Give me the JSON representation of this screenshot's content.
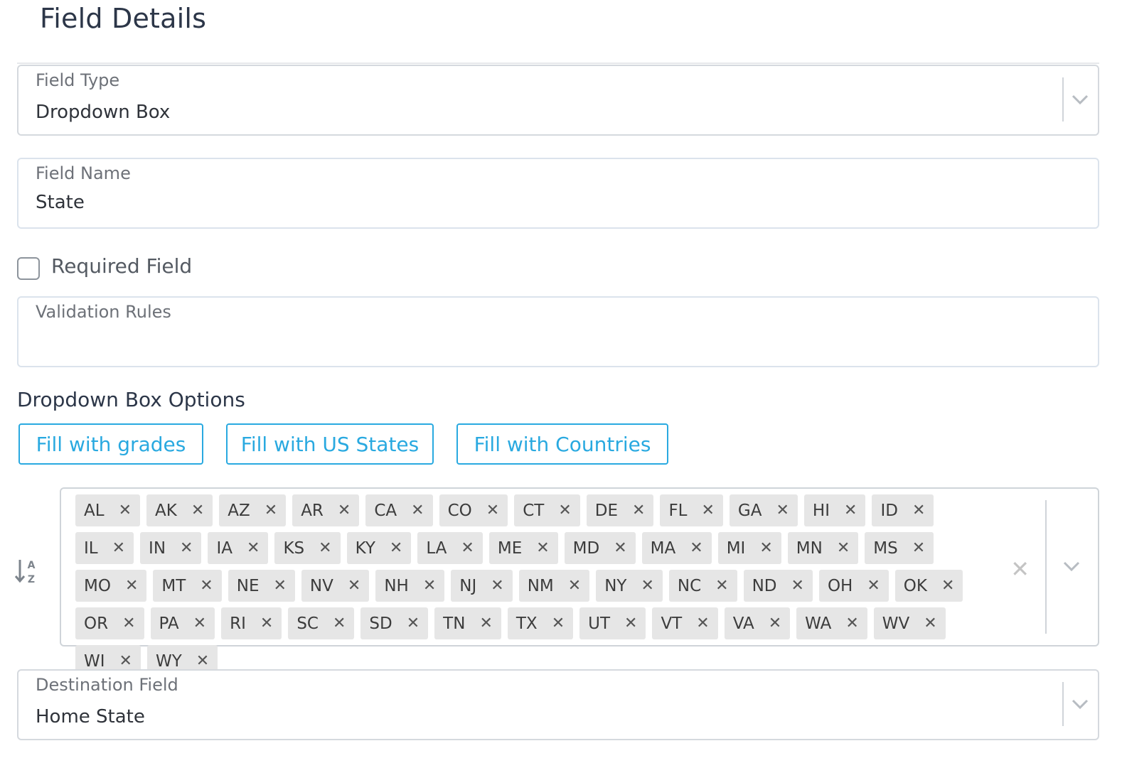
{
  "page": {
    "title": "Field Details"
  },
  "field_type": {
    "label": "Field Type",
    "value": "Dropdown Box"
  },
  "field_name": {
    "label": "Field Name",
    "value": "State"
  },
  "required": {
    "label": "Required Field",
    "checked": false
  },
  "validation": {
    "label": "Validation Rules",
    "value": ""
  },
  "options": {
    "heading": "Dropdown Box Options",
    "buttons": {
      "grades": "Fill with grades",
      "us_states": "Fill with US States",
      "countries": "Fill with Countries"
    },
    "tags": [
      "AL",
      "AK",
      "AZ",
      "AR",
      "CA",
      "CO",
      "CT",
      "DE",
      "FL",
      "GA",
      "HI",
      "ID",
      "IL",
      "IN",
      "IA",
      "KS",
      "KY",
      "LA",
      "ME",
      "MD",
      "MA",
      "MI",
      "MN",
      "MS",
      "MO",
      "MT",
      "NE",
      "NV",
      "NH",
      "NJ",
      "NM",
      "NY",
      "NC",
      "ND",
      "OH",
      "OK",
      "OR",
      "PA",
      "RI",
      "SC",
      "SD",
      "TN",
      "TX",
      "UT",
      "VT",
      "VA",
      "WA",
      "WV",
      "WI",
      "WY"
    ],
    "remove_glyph": "✕",
    "clear_glyph": "✕"
  },
  "destination": {
    "label": "Destination Field",
    "value": "Home State"
  },
  "colors": {
    "accent": "#29a9e0",
    "tag_bg": "#e6e6e6",
    "border": "#d5d9de"
  },
  "icons": {
    "select_arrow": "chevron-down-icon",
    "sort": "sort-alpha-down-icon",
    "remove": "close-icon"
  }
}
